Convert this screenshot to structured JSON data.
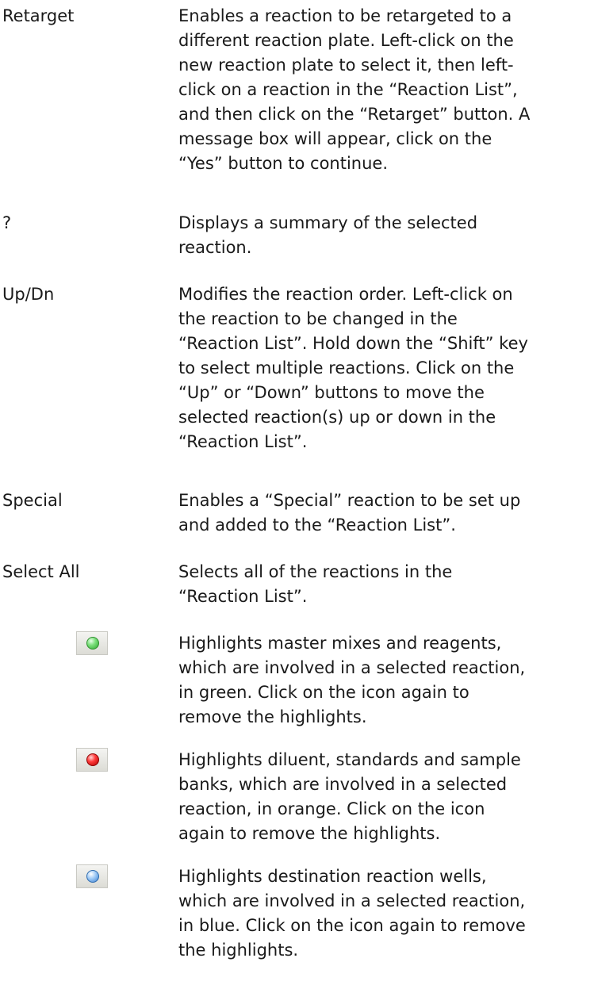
{
  "entries": [
    {
      "term": "Retarget",
      "lines": [
        "Enables a reaction to be retargeted to a",
        "different reaction plate. Left-click on the",
        "new reaction plate to select it, then left-",
        "click on a reaction in the “Reaction List”,",
        "and then click on the “Retarget” button. A",
        "message box will appear, click on the",
        "“Yes” button to continue."
      ]
    },
    {
      "term": "?",
      "lines": [
        "Displays a summary of the selected",
        "reaction."
      ]
    },
    {
      "term": "Up/Dn",
      "lines": [
        "Modifies the reaction order. Left-click on",
        "the reaction to be changed in the",
        "“Reaction List”. Hold down the “Shift” key",
        "to select multiple reactions. Click on the",
        "“Up” or “Down” buttons to move the",
        "selected reaction(s) up or down in the",
        "“Reaction List”."
      ]
    },
    {
      "term": "Special",
      "lines": [
        "Enables a “Special” reaction to be set up",
        "and added to the “Reaction List”."
      ]
    },
    {
      "term": "Select All",
      "lines": [
        "Selects all of the reactions in the",
        "“Reaction List”."
      ]
    },
    {
      "icon": "green-circle-icon",
      "lines": [
        "Highlights master mixes and reagents,",
        "which are involved in a selected reaction,",
        "in green. Click on the icon again to",
        "remove the highlights."
      ]
    },
    {
      "icon": "red-circle-icon",
      "lines": [
        "Highlights diluent, standards and sample",
        "banks, which are involved in a selected",
        "reaction, in orange. Click on the icon",
        "again to remove the highlights."
      ]
    },
    {
      "icon": "blue-circle-icon",
      "lines": [
        "Highlights destination reaction wells,",
        "which are involved in a selected reaction,",
        "in blue. Click on the icon again to remove",
        "the highlights."
      ]
    }
  ],
  "colors": {
    "green": "#3cbf3c",
    "red": "#e00000",
    "blue": "#7fb3ea"
  }
}
